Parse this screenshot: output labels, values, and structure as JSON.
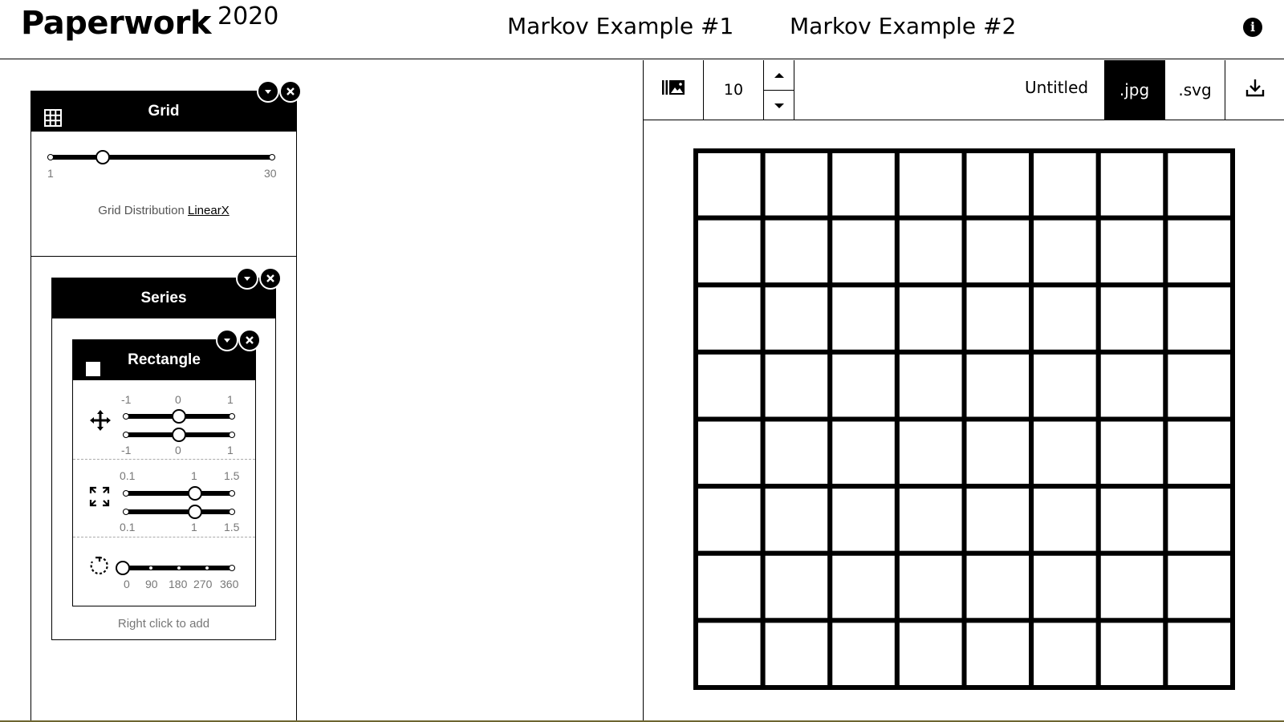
{
  "header": {
    "brand": "Paperwork",
    "year": "2020",
    "nav": [
      "Markov Example #1",
      "Markov Example #2"
    ],
    "info_icon": "info-icon"
  },
  "grid_panel": {
    "title": "Grid",
    "icon": "grid-icon",
    "size_slider": {
      "min_label": "1",
      "max_label": "30",
      "value": 8,
      "min": 1,
      "max": 30
    },
    "distribution_label": "Grid Distribution",
    "distribution_value": "LinearX"
  },
  "series_panel": {
    "title": "Series",
    "hint": "Right click to add",
    "rectangle": {
      "title": "Rectangle",
      "icon": "square-icon",
      "position": {
        "icon": "move-icon",
        "top_labels": [
          "-1",
          "0",
          "1"
        ],
        "bottom_labels": [
          "-1",
          "0",
          "1"
        ],
        "x_value": 0,
        "y_value": 0
      },
      "scale": {
        "icon": "expand-icon",
        "top_labels": [
          "0.1",
          "1",
          "1.5"
        ],
        "bottom_labels": [
          "0.1",
          "1",
          "1.5"
        ],
        "x_value": 1,
        "y_value": 1
      },
      "rotation": {
        "icon": "rotate-icon",
        "labels": [
          "0",
          "90",
          "180",
          "270",
          "360"
        ],
        "value": 0
      }
    }
  },
  "toolbar": {
    "gallery_icon": "gallery-icon",
    "count": "10",
    "title": "Untitled",
    "format_jpg": ".jpg",
    "format_svg": ".svg",
    "download_icon": "download-icon",
    "active_format": ".jpg"
  },
  "canvas": {
    "rows": 8,
    "cols": 8,
    "stroke_color": "#000000",
    "fill_color": "#ffffff"
  }
}
